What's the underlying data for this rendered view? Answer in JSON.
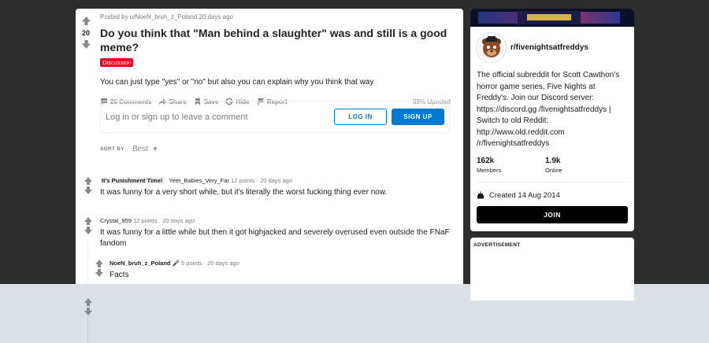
{
  "colors": {
    "accent": "#0079d3",
    "flair": "#ea0027",
    "join": "#000000"
  },
  "post": {
    "score": "20",
    "meta": "Posted by u/NoeN_bruh_z_Poland 20 days ago",
    "title": "Do you think that \"Man behind a slaughter\" was and still is a good meme?",
    "flair": "Discussion",
    "body": "You can just type \"yes\" or \"no\" but also you can explain why you think that way",
    "actions": {
      "comments": "26 Comments",
      "share": "Share",
      "save": "Save",
      "hide": "Hide",
      "report": "Report",
      "upvoted": "89% Upvoted"
    }
  },
  "login": {
    "prompt": "Log in or sign up to leave a comment",
    "login_label": "LOG IN",
    "signup_label": "SIGN UP"
  },
  "sort": {
    "label": "SORT BY",
    "value": "Best"
  },
  "comments": [
    {
      "flair": "It's Punishment Time!",
      "author": "Yeet_Babies_Very_Far",
      "points": "12 points",
      "sep": "·",
      "time": "20 days ago",
      "text": "It was funny for a very short while, but it's literally the worst fucking thing ever now."
    },
    {
      "author": "Crystal_959",
      "points": "12 points",
      "sep": "·",
      "time": "20 days ago",
      "text": "It was funny for a little while but then it got highjacked and severely overused even outside the FNaF fandom"
    },
    {
      "author": "NoeN_bruh_z_Poland",
      "points": "5 points",
      "sep": "·",
      "time": "20 days ago",
      "text": "Facts"
    }
  ],
  "sidebar": {
    "sub_name": "r/fivenightsatfreddys",
    "description": "The official subreddit for Scott Cawthon's horror game series, Five Nights at Freddy's. Join our Discord server: https://discord.gg /fivenightsatfreddys | Switch to old Reddit: http://www.old.reddit.com /r/fivenightsatfreddys",
    "members_count": "162k",
    "members_label": "Members",
    "online_count": "1.9k",
    "online_label": "Online",
    "created": "Created 14 Aug 2014",
    "join_label": "JOIN",
    "ad_label": "ADVERTISEMENT"
  }
}
